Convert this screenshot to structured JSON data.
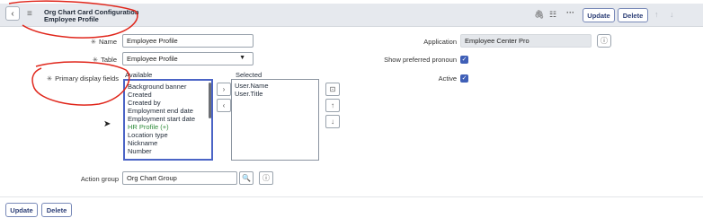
{
  "header": {
    "title_line1": "Org Chart Card Configuration",
    "title_line2": "Employee Profile",
    "update_label": "Update",
    "delete_label": "Delete"
  },
  "form": {
    "name_label": "Name",
    "name_value": "Employee Profile",
    "table_label": "Table",
    "table_value": "Employee Profile",
    "primary_display_label": "Primary display fields",
    "available_label": "Available",
    "selected_label": "Selected",
    "available_items": [
      "Background banner",
      "Created",
      "Created by",
      "Employment end date",
      "Employment start date",
      "HR Profile (+)",
      "Location type",
      "Nickname",
      "Number"
    ],
    "selected_items": [
      "User.Name",
      "User.Title"
    ],
    "application_label": "Application",
    "application_value": "Employee Center Pro",
    "pronoun_label": "Show preferred pronoun",
    "active_label": "Active",
    "action_group_label": "Action group",
    "action_group_value": "Org Chart Group"
  },
  "footer": {
    "update_label": "Update",
    "delete_label": "Delete"
  },
  "colors": {
    "accent": "#3f5fb7",
    "annotation": "#e0261b"
  }
}
